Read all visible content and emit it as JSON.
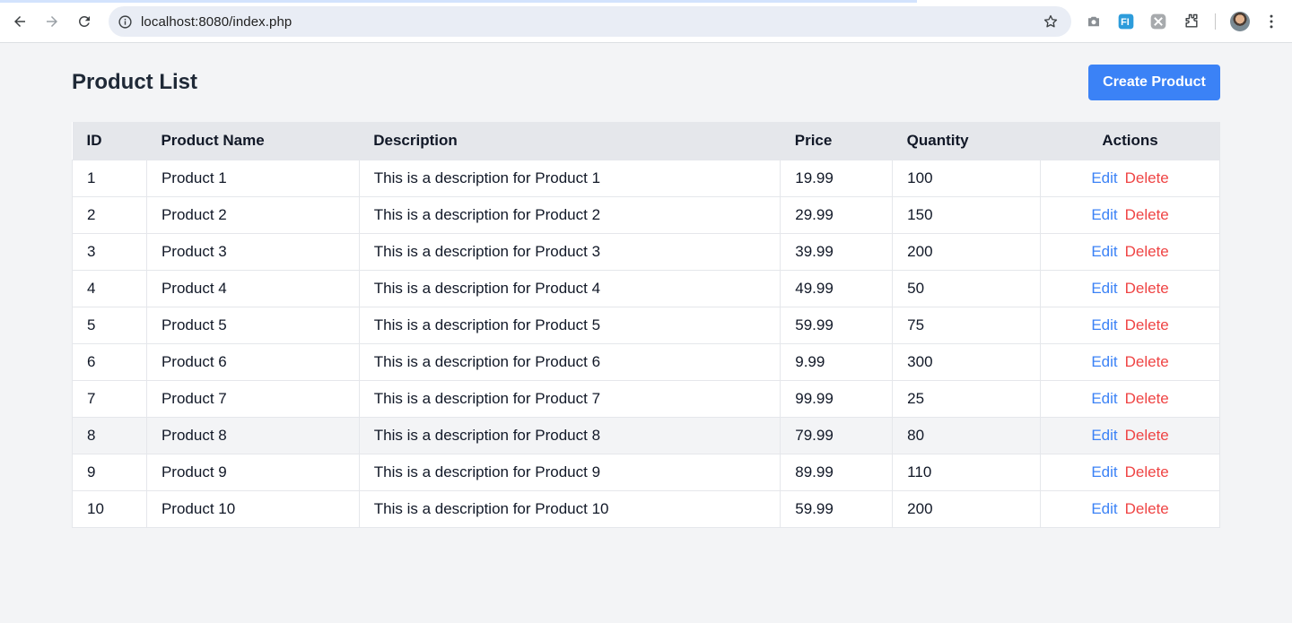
{
  "browser": {
    "url": "localhost:8080/index.php",
    "icons": {
      "back": "arrow-left-icon",
      "forward": "arrow-right-icon",
      "reload": "reload-icon",
      "site_info": "info-icon",
      "bookmark": "star-icon",
      "screenshot": "camera-icon",
      "extension1": "fi-extension-icon",
      "extension2": "puzzle-ext-icon",
      "extensions": "extensions-icon",
      "menu": "kebab-menu-icon"
    }
  },
  "page": {
    "title": "Product List",
    "create_label": "Create Product"
  },
  "table": {
    "headers": {
      "id": "ID",
      "name": "Product Name",
      "description": "Description",
      "price": "Price",
      "quantity": "Quantity",
      "actions": "Actions"
    },
    "edit_label": "Edit",
    "delete_label": "Delete",
    "rows": [
      {
        "id": "1",
        "name": "Product 1",
        "description": "This is a description for Product 1",
        "price": "19.99",
        "quantity": "100"
      },
      {
        "id": "2",
        "name": "Product 2",
        "description": "This is a description for Product 2",
        "price": "29.99",
        "quantity": "150"
      },
      {
        "id": "3",
        "name": "Product 3",
        "description": "This is a description for Product 3",
        "price": "39.99",
        "quantity": "200"
      },
      {
        "id": "4",
        "name": "Product 4",
        "description": "This is a description for Product 4",
        "price": "49.99",
        "quantity": "50"
      },
      {
        "id": "5",
        "name": "Product 5",
        "description": "This is a description for Product 5",
        "price": "59.99",
        "quantity": "75"
      },
      {
        "id": "6",
        "name": "Product 6",
        "description": "This is a description for Product 6",
        "price": "9.99",
        "quantity": "300"
      },
      {
        "id": "7",
        "name": "Product 7",
        "description": "This is a description for Product 7",
        "price": "99.99",
        "quantity": "25"
      },
      {
        "id": "8",
        "name": "Product 8",
        "description": "This is a description for Product 8",
        "price": "79.99",
        "quantity": "80"
      },
      {
        "id": "9",
        "name": "Product 9",
        "description": "This is a description for Product 9",
        "price": "89.99",
        "quantity": "110"
      },
      {
        "id": "10",
        "name": "Product 10",
        "description": "This is a description for Product 10",
        "price": "59.99",
        "quantity": "200"
      }
    ]
  },
  "colors": {
    "page_bg": "#f3f4f6",
    "primary": "#3b82f6",
    "danger": "#ef4444",
    "header_bg": "#e5e7eb",
    "text": "#1f2937"
  }
}
